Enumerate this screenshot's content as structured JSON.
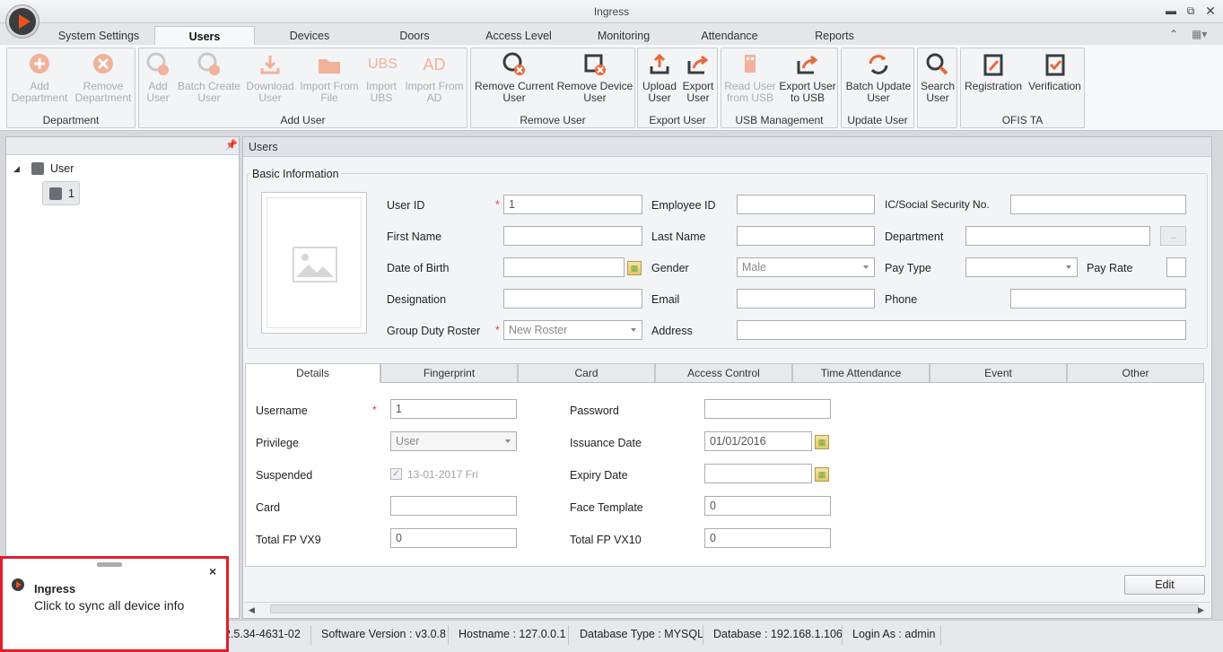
{
  "window": {
    "title": "Ingress"
  },
  "ribbon_tabs": [
    "System Settings",
    "Users",
    "Devices",
    "Doors",
    "Access Level",
    "Monitoring",
    "Attendance",
    "Reports"
  ],
  "ribbon": {
    "department": {
      "label": "Department",
      "add": "Add\nDepartment",
      "remove": "Remove\nDepartment"
    },
    "add_user": {
      "label": "Add User",
      "add": "Add\nUser",
      "batch": "Batch Create\nUser",
      "download": "Download\nUser",
      "import_file": "Import From\nFile",
      "import_ubs": "Import\nUBS",
      "import_ad": "Import From\nAD",
      "ubs_icon": "UBS",
      "ad_icon": "AD"
    },
    "remove_user": {
      "label": "Remove User",
      "current": "Remove Current\nUser",
      "device": "Remove Device\nUser"
    },
    "export_user": {
      "label": "Export User",
      "upload": "Upload\nUser",
      "export": "Export\nUser"
    },
    "usb": {
      "label": "USB Management",
      "read": "Read User\nfrom USB",
      "export": "Export User\nto USB"
    },
    "update_user": {
      "label": "Update User",
      "batch": "Batch Update\nUser"
    },
    "search": {
      "label": "Search\nUser"
    },
    "ofis": {
      "label": "OFIS TA",
      "registration": "Registration",
      "verification": "Verification"
    }
  },
  "tree": {
    "root": "User",
    "child": "1"
  },
  "users_title": "Users",
  "basic": {
    "legend": "Basic Information",
    "user_id_label": "User ID",
    "user_id": "1",
    "employee_id_label": "Employee ID",
    "ic_label": "IC/Social Security No.",
    "first_name_label": "First Name",
    "last_name_label": "Last Name",
    "department_label": "Department",
    "browse": "..",
    "dob_label": "Date of Birth",
    "gender_label": "Gender",
    "gender": "Male",
    "pay_type_label": "Pay Type",
    "pay_rate_label": "Pay Rate",
    "designation_label": "Designation",
    "email_label": "Email",
    "phone_label": "Phone",
    "roster_label": "Group Duty Roster",
    "roster": "New Roster",
    "address_label": "Address",
    "required_mark": "*"
  },
  "detail_tabs": [
    "Details",
    "Fingerprint",
    "Card",
    "Access Control",
    "Time Attendance",
    "Event",
    "Other"
  ],
  "details": {
    "username_label": "Username",
    "username": "1",
    "password_label": "Password",
    "privilege_label": "Privilege",
    "privilege": "User",
    "issuance_label": "Issuance Date",
    "issuance": "01/01/2016",
    "suspended_label": "Suspended",
    "suspended_date": "13-01-2017 Fri",
    "expiry_label": "Expiry Date",
    "card_label": "Card",
    "face_label": "Face Template",
    "face": "0",
    "fp9_label": "Total FP VX9",
    "fp9": "0",
    "fp10_label": "Total FP VX10",
    "fp10": "0",
    "edit": "Edit"
  },
  "status": {
    "version_fragment": "2.5.34-4631-02",
    "software": "Software Version : v3.0.8",
    "hostname": "Hostname : 127.0.0.1",
    "dbtype": "Database Type : MYSQL",
    "database": "Database : 192.168.1.106",
    "login": "Login As : admin"
  },
  "notification": {
    "title": "Ingress",
    "message": "Click to sync all device info",
    "close": "×"
  },
  "colors": {
    "accent": "#e8541c",
    "ribbon_icon": "#e86a3a",
    "notify_border": "#e01f2b"
  }
}
